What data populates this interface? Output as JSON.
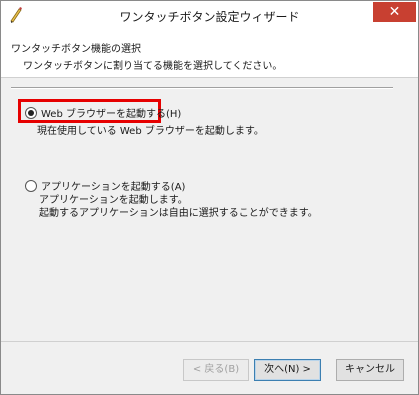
{
  "window": {
    "title": "ワンタッチボタン設定ウィザード",
    "close_glyph": "✕"
  },
  "header": {
    "title": "ワンタッチボタン機能の選択",
    "description": "ワンタッチボタンに割り当てる機能を選択してください。"
  },
  "options": [
    {
      "label": "Web ブラウザーを起動する(H)",
      "selected": true,
      "description_lines": [
        "現在使用している Web ブラウザーを起動します。"
      ]
    },
    {
      "label": "アプリケーションを起動する(A)",
      "selected": false,
      "description_lines": [
        "アプリケーションを起動します。",
        "起動するアプリケーションは自由に選択することができます。"
      ]
    }
  ],
  "buttons": {
    "back": "< 戻る(B)",
    "next": "次へ(N) >",
    "cancel": "キャンセル"
  },
  "colors": {
    "highlight": "#e60000",
    "close": "#c84031"
  },
  "icons": {
    "app": "pen-icon",
    "close": "close-icon"
  }
}
